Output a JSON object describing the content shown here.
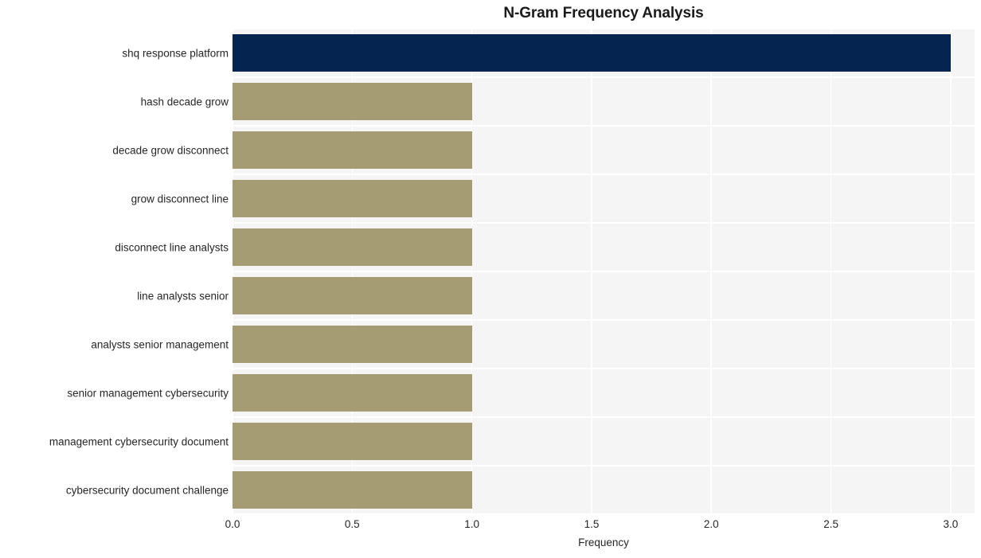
{
  "chart_data": {
    "type": "bar",
    "orientation": "horizontal",
    "title": "N-Gram Frequency Analysis",
    "xlabel": "Frequency",
    "ylabel": "",
    "xlim": [
      0.0,
      3.1
    ],
    "xticks": [
      "0.0",
      "0.5",
      "1.0",
      "1.5",
      "2.0",
      "2.5",
      "3.0"
    ],
    "xtick_values": [
      0.0,
      0.5,
      1.0,
      1.5,
      2.0,
      2.5,
      3.0
    ],
    "grid": true,
    "grid_color": "#ffffff",
    "plot_background": "#f5f5f6",
    "figure_background": "#ffffff",
    "legend": null,
    "categories": [
      "shq response platform",
      "hash decade grow",
      "decade grow disconnect",
      "grow disconnect line",
      "disconnect line analysts",
      "line analysts senior",
      "analysts senior management",
      "senior management cybersecurity",
      "management cybersecurity document",
      "cybersecurity document challenge"
    ],
    "values": [
      3,
      1,
      1,
      1,
      1,
      1,
      1,
      1,
      1,
      1
    ],
    "bar_colors": [
      "#052450",
      "#a59c74",
      "#a59c74",
      "#a59c74",
      "#a59c74",
      "#a59c74",
      "#a59c74",
      "#a59c74",
      "#a59c74",
      "#a59c74"
    ],
    "highlight_color": "#052450",
    "base_color": "#a59c74"
  }
}
